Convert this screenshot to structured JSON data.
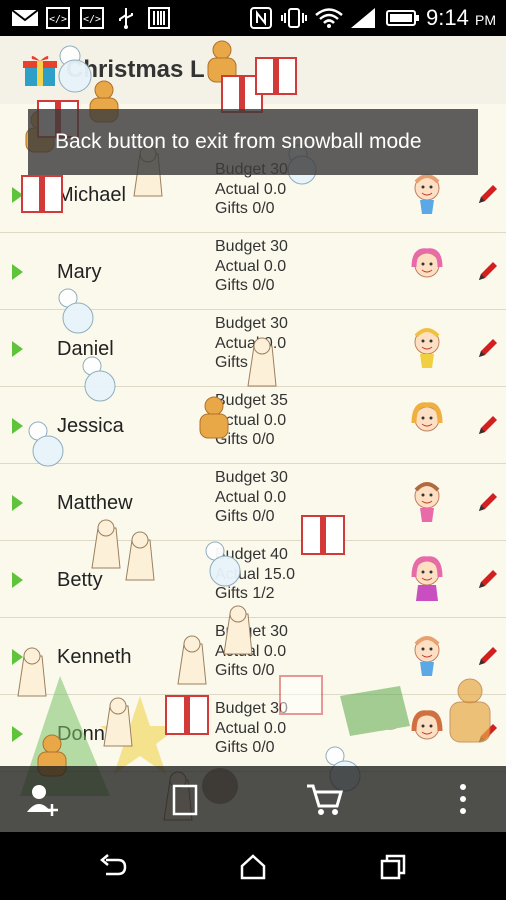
{
  "status_bar": {
    "time": "9:14",
    "ampm": "PM",
    "icons": [
      "mail-icon",
      "code-icon",
      "code-icon",
      "usb-icon",
      "barcode-icon",
      "nfc-icon",
      "vibrate-icon",
      "wifi-icon",
      "signal-icon",
      "battery-icon"
    ]
  },
  "app": {
    "title": "Christmas L",
    "toast": "Back button to exit from snowball mode"
  },
  "people": [
    {
      "name": "Michael",
      "budget": "Budget 30",
      "actual": "Actual 0.0",
      "gifts": "Gifts  0/0",
      "avatar_hair": "#e8a070",
      "avatar_gender": "boy"
    },
    {
      "name": "Mary",
      "budget": "Budget 30",
      "actual": "Actual 0.0",
      "gifts": "Gifts  0/0",
      "avatar_hair": "#e86aa8",
      "avatar_gender": "girl"
    },
    {
      "name": "Daniel",
      "budget": "Budget 30",
      "actual": "Actual 0.0",
      "gifts": "Gifts  0/1",
      "avatar_hair": "#f0c040",
      "avatar_gender": "boy"
    },
    {
      "name": "Jessica",
      "budget": "Budget 35",
      "actual": "Actual 0.0",
      "gifts": "Gifts  0/0",
      "avatar_hair": "#f0b040",
      "avatar_gender": "girl"
    },
    {
      "name": "Matthew",
      "budget": "Budget 30",
      "actual": "Actual 0.0",
      "gifts": "Gifts  0/0",
      "avatar_hair": "#b06a40",
      "avatar_gender": "boy"
    },
    {
      "name": "Betty",
      "budget": "Budget 40",
      "actual": "Actual 15.0",
      "gifts": "Gifts  1/2",
      "avatar_hair": "#e86aa8",
      "avatar_gender": "girl"
    },
    {
      "name": "Kenneth",
      "budget": "Budget 30",
      "actual": "Actual 0.0",
      "gifts": "Gifts  0/0",
      "avatar_hair": "#e8a070",
      "avatar_gender": "boy"
    },
    {
      "name": "Donna",
      "budget": "Budget 30",
      "actual": "Actual 0.0",
      "gifts": "Gifts  0/0",
      "avatar_hair": "#d07040",
      "avatar_gender": "girl"
    }
  ],
  "bottom_bar": {
    "buttons": [
      "add-person-icon",
      "list-icon",
      "cart-icon",
      "overflow-menu-icon"
    ]
  },
  "nav_bar": {
    "buttons": [
      "back-icon",
      "home-icon",
      "recents-icon"
    ]
  },
  "colors": {
    "background": "#fbf9ec",
    "arrow": "#5fc43b",
    "edit": "#d21f1f",
    "toast": "#3c3c3c"
  }
}
